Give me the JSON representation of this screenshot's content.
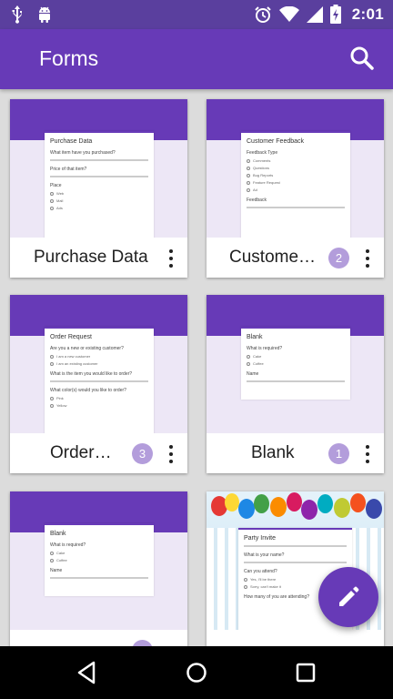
{
  "status_bar": {
    "time": "2:01",
    "left_icons": [
      "usb-icon",
      "android-icon"
    ],
    "right_icons": [
      "alarm-icon",
      "wifi-icon",
      "signal-icon",
      "battery-charging-icon"
    ]
  },
  "app_bar": {
    "title": "Forms",
    "search_icon": "search-icon"
  },
  "forms": [
    {
      "name": "Purchase Data",
      "badge": "",
      "preview": {
        "title": "Purchase Data",
        "questions": [
          "What item have you purchased?",
          "Price of that item?",
          "Place"
        ],
        "options": [
          "Web",
          "Mall",
          "Ads"
        ]
      }
    },
    {
      "name": "Customer…",
      "badge": "2",
      "preview": {
        "title": "Customer Feedback",
        "questions": [
          "Feedback Type",
          "Feedback"
        ],
        "options": [
          "Comments",
          "Questions",
          "Bug Reports",
          "Feature Request",
          "Ad"
        ]
      }
    },
    {
      "name": "Order…",
      "badge": "3",
      "preview": {
        "title": "Order Request",
        "questions": [
          "Are you a new or existing customer?",
          "What is the item you would like to order?",
          "What color(s) would you like to order?"
        ],
        "options": [
          "I am a new customer",
          "I am an existing customer",
          "Pink",
          "Yellow"
        ]
      }
    },
    {
      "name": "Blank",
      "badge": "1",
      "preview": {
        "title": "Blank",
        "questions": [
          "What is required?",
          "Name"
        ],
        "options": [
          "Cake",
          "Coffee"
        ]
      }
    },
    {
      "name": "",
      "badge": "",
      "preview": {
        "title": "Blank",
        "questions": [
          "What is required?",
          "Name"
        ],
        "options": [
          "Cake",
          "Coffee"
        ]
      }
    },
    {
      "name": "",
      "badge": "",
      "preview": {
        "title": "Party Invite",
        "questions": [
          "What is your name?",
          "Can you attend?",
          "How many of you are attending?"
        ],
        "options": [
          "Yes, I'll be there",
          "Sorry, can't make it"
        ]
      }
    }
  ],
  "fab": {
    "icon": "edit-pencil-icon"
  },
  "nav_bar": {
    "icons": [
      "back-icon",
      "home-icon",
      "recents-icon"
    ]
  },
  "colors": {
    "status_bar": "#5a3f9e",
    "primary": "#673ab7",
    "badge": "#b39ddb",
    "thumb_bg": "#ede7f6"
  }
}
